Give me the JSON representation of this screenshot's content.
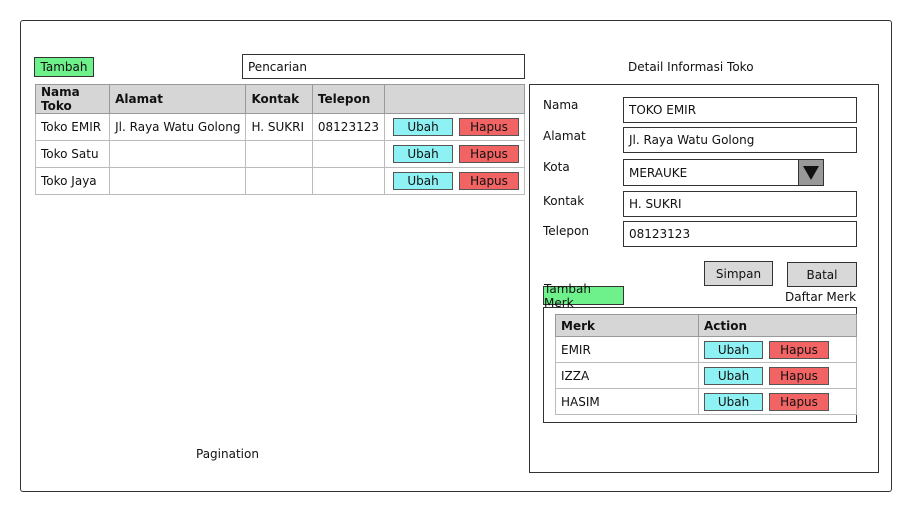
{
  "toolbar": {
    "add_label": "Tambah",
    "search_value": "Pencarian"
  },
  "store_table": {
    "headers": [
      "Nama Toko",
      "Alamat",
      "Kontak",
      "Telepon",
      ""
    ],
    "rows": [
      {
        "nama": "Toko EMIR",
        "alamat": "Jl. Raya Watu Golong",
        "kontak": "H. SUKRI",
        "telepon": "08123123",
        "edit": "Ubah",
        "delete": "Hapus"
      },
      {
        "nama": "Toko Satu",
        "alamat": "",
        "kontak": "",
        "telepon": "",
        "edit": "Ubah",
        "delete": "Hapus"
      },
      {
        "nama": "Toko Jaya",
        "alamat": "",
        "kontak": "",
        "telepon": "",
        "edit": "Ubah",
        "delete": "Hapus"
      }
    ]
  },
  "pagination_label": "Pagination",
  "detail": {
    "title": "Detail Informasi Toko",
    "fields": {
      "nama": {
        "label": "Nama",
        "value": "TOKO EMIR"
      },
      "alamat": {
        "label": "Alamat",
        "value": "Jl. Raya Watu Golong"
      },
      "kota": {
        "label": "Kota",
        "value": "MERAUKE"
      },
      "kontak": {
        "label": "Kontak",
        "value": "H. SUKRI"
      },
      "telepon": {
        "label": "Telepon",
        "value": "08123123"
      }
    },
    "save_label": "Simpan",
    "cancel_label": "Batal",
    "add_brand_label": "Tambah Merk",
    "brand_list_title": "Daftar Merk",
    "brand_table": {
      "headers": [
        "Merk",
        "Action"
      ],
      "rows": [
        {
          "merk": "EMIR",
          "edit": "Ubah",
          "delete": "Hapus"
        },
        {
          "merk": "IZZA",
          "edit": "Ubah",
          "delete": "Hapus"
        },
        {
          "merk": "HASIM",
          "edit": "Ubah",
          "delete": "Hapus"
        }
      ]
    }
  },
  "colors": {
    "green": "#6ef08a",
    "cyan": "#8ef1f4",
    "red": "#f26363",
    "gray": "#d8d8d8"
  }
}
